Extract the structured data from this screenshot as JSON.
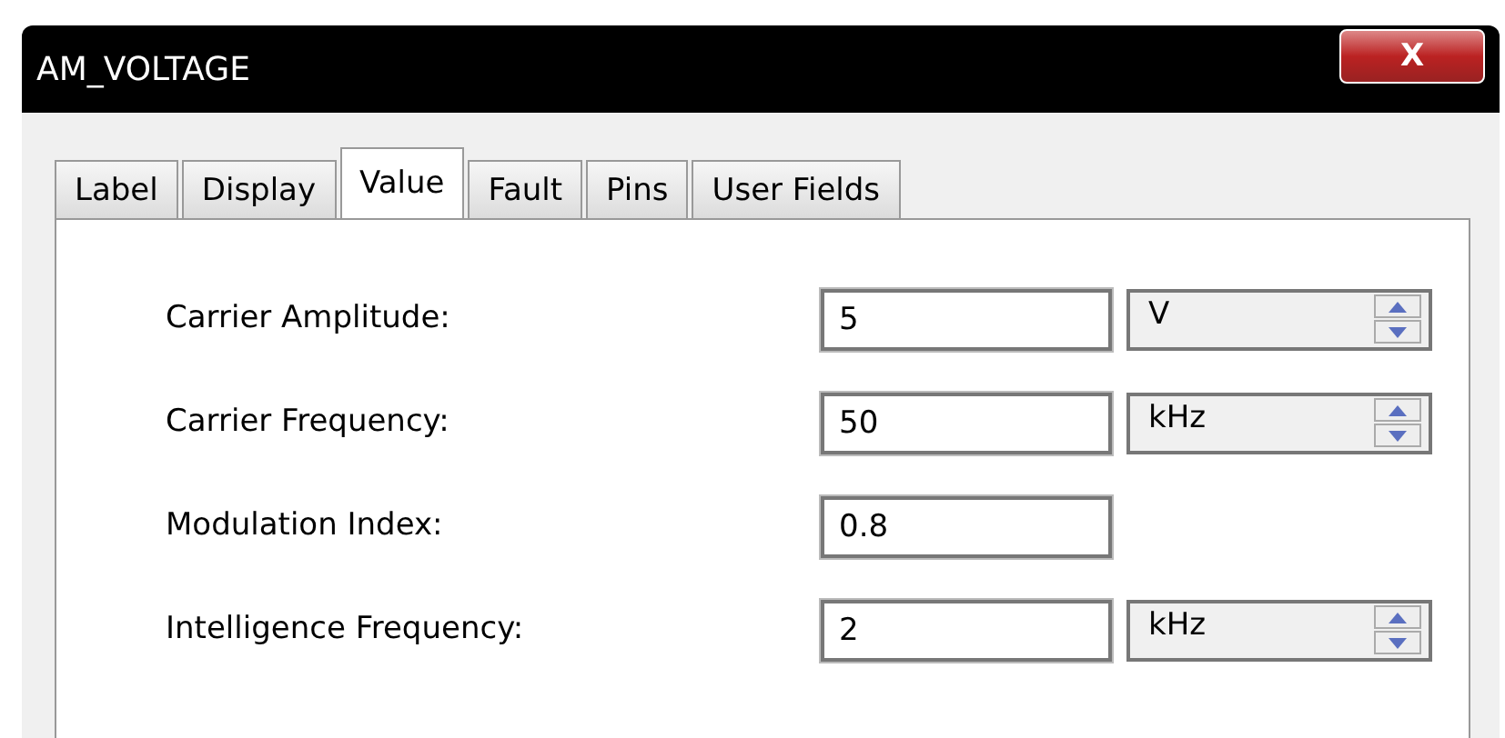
{
  "window": {
    "title": "AM_VOLTAGE",
    "close": "X"
  },
  "tabs": [
    {
      "label": "Label",
      "selected": false
    },
    {
      "label": "Display",
      "selected": false
    },
    {
      "label": "Value",
      "selected": true
    },
    {
      "label": "Fault",
      "selected": false
    },
    {
      "label": "Pins",
      "selected": false
    },
    {
      "label": "User Fields",
      "selected": false
    }
  ],
  "fields": [
    {
      "label": "Carrier Amplitude:",
      "value": "5",
      "unit": "V"
    },
    {
      "label": "Carrier Frequency:",
      "value": "50",
      "unit": "kHz"
    },
    {
      "label": "Modulation Index:",
      "value": "0.8"
    },
    {
      "label": "Intelligence Frequency:",
      "value": "2",
      "unit": "kHz"
    }
  ]
}
